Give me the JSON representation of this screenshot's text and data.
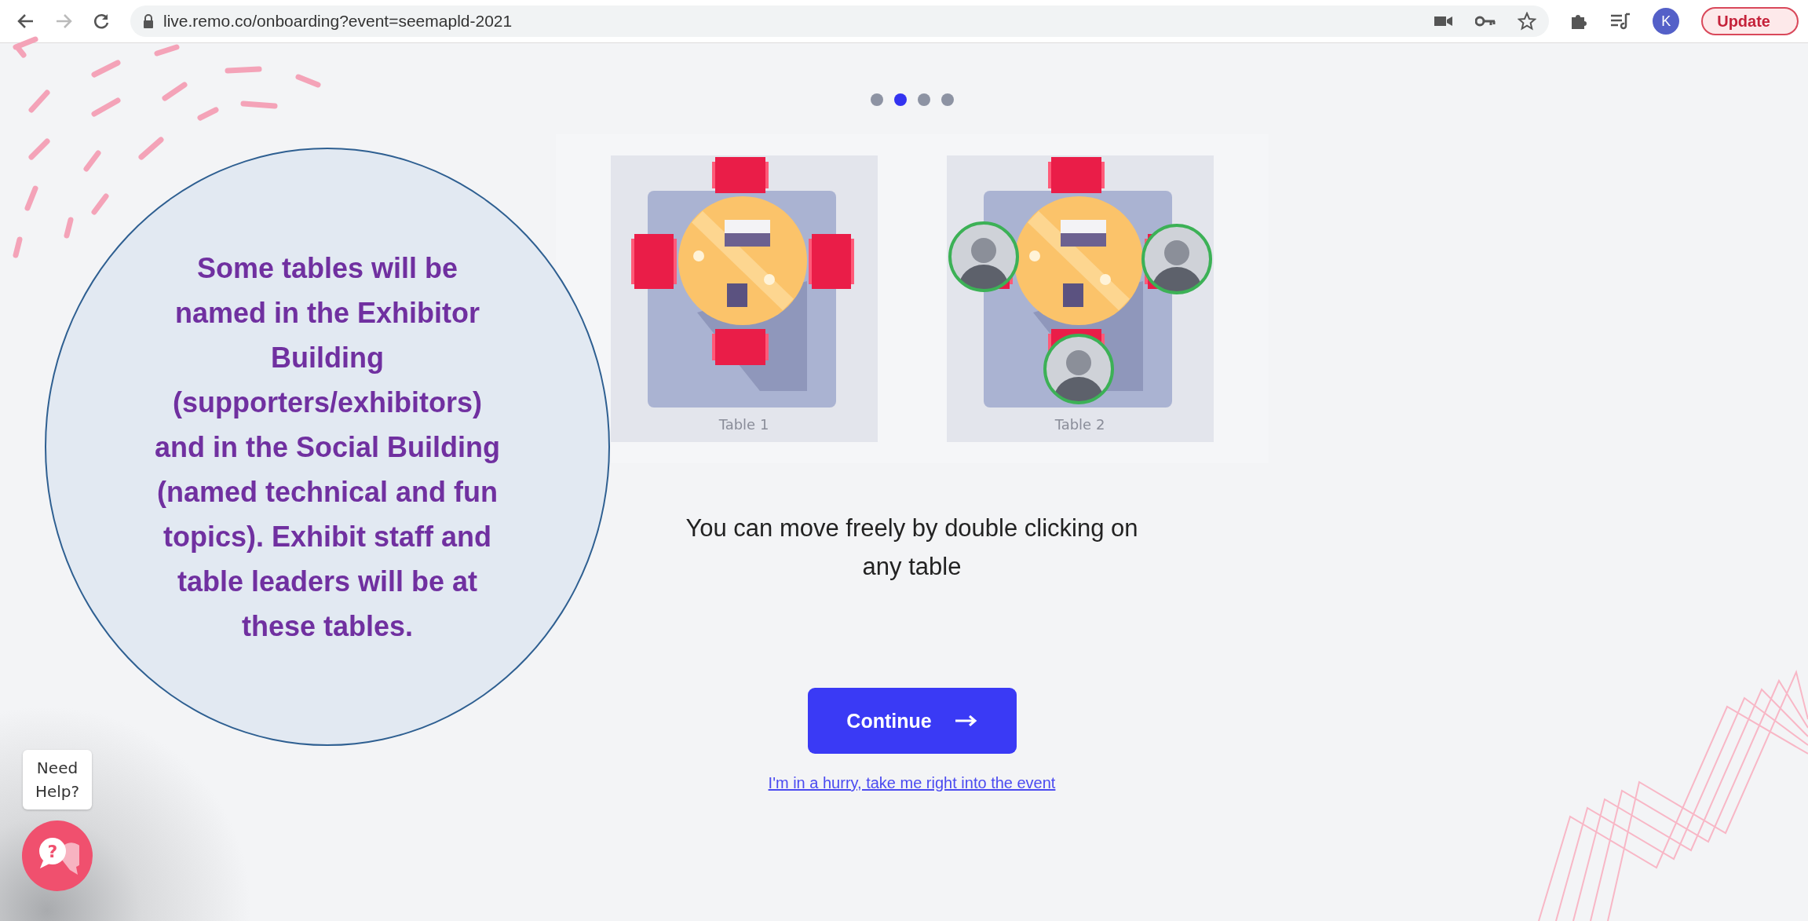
{
  "browser": {
    "url": "live.remo.co/onboarding?event=seemapld-2021",
    "profile_initial": "K",
    "update_button": "Update"
  },
  "stepper": [
    {
      "selected": false
    },
    {
      "selected": true
    },
    {
      "selected": false
    },
    {
      "selected": false
    }
  ],
  "tables": [
    {
      "label": "Table 1",
      "seats": [
        {
          "occupied": false
        },
        {
          "occupied": false
        },
        {
          "occupied": false
        },
        {
          "occupied": false
        }
      ]
    },
    {
      "label": "Table 2",
      "seats": [
        {
          "occupied": false
        },
        {
          "occupied": true
        },
        {
          "occupied": true
        },
        {
          "occupied": true
        }
      ]
    }
  ],
  "message": "You can move freely by double clicking on any table",
  "continue_button": "Continue",
  "skip_link": "I'm in a hurry, take me right into the event",
  "callout": "Some tables will be named in the Exhibitor Building (supporters/exhibitors) and in the Social Building (named technical and fun topics). Exhibit staff and table leaders will be at these tables.",
  "help": {
    "label": "Need Help?",
    "icon": "?"
  }
}
